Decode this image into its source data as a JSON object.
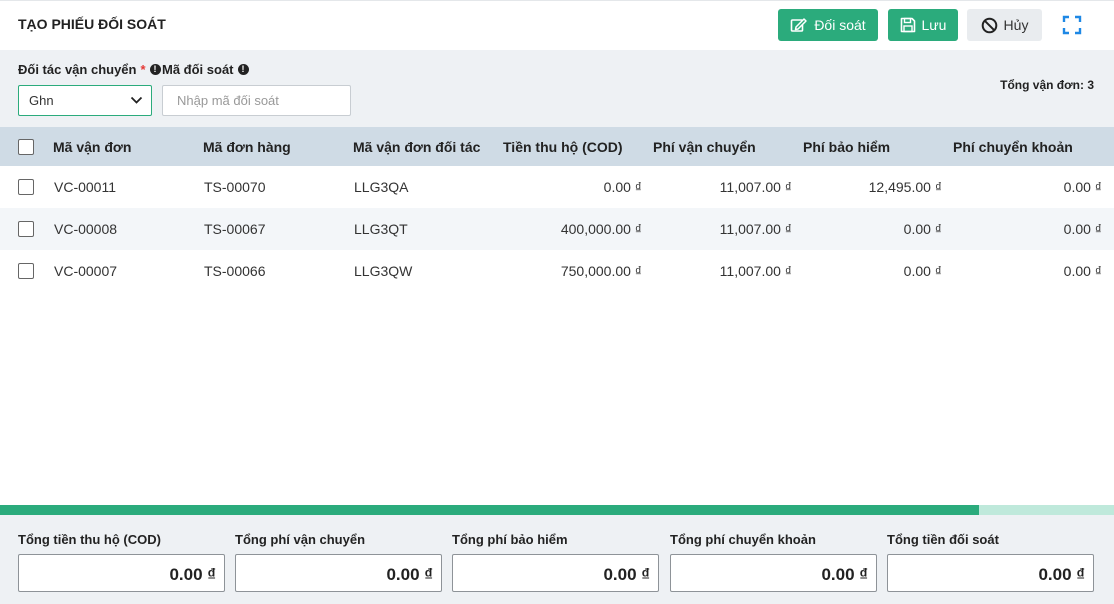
{
  "header": {
    "title": "TẠO PHIẾU ĐỐI SOÁT",
    "reconcile_label": "Đối soát",
    "save_label": "Lưu",
    "cancel_label": "Hủy"
  },
  "filters": {
    "carrier_label": "Đối tác vận chuyển",
    "carrier_required": "*",
    "carrier_value": "Ghn",
    "code_label": "Mã đối soát",
    "code_placeholder": "Nhập mã đối soát",
    "code_value": "",
    "total_orders_text": "Tổng vận đơn: 3"
  },
  "table": {
    "headers": [
      "Mã vận đơn",
      "Mã đơn hàng",
      "Mã vận đơn đối tác",
      "Tiền thu hộ (COD)",
      "Phí vận chuyển",
      "Phí bảo hiểm",
      "Phí chuyển khoản"
    ],
    "rows": [
      [
        "VC-00011",
        "TS-00070",
        "LLG3QA",
        "0.00 ₫",
        "11,007.00 ₫",
        "12,495.00 ₫",
        "0.00 ₫"
      ],
      [
        "VC-00008",
        "TS-00067",
        "LLG3QT",
        "400,000.00 ₫",
        "11,007.00 ₫",
        "0.00 ₫",
        "0.00 ₫"
      ],
      [
        "VC-00007",
        "TS-00066",
        "LLG3QW",
        "750,000.00 ₫",
        "11,007.00 ₫",
        "0.00 ₫",
        "0.00 ₫"
      ]
    ]
  },
  "scroll_progress": 0.879,
  "summary": {
    "items": [
      {
        "label": "Tổng tiền thu hộ (COD)",
        "value": "0.00 ₫"
      },
      {
        "label": "Tổng phí vận chuyển",
        "value": "0.00 ₫"
      },
      {
        "label": "Tổng phí bảo hiểm",
        "value": "0.00 ₫"
      },
      {
        "label": "Tổng phí chuyển khoản",
        "value": "0.00 ₫"
      },
      {
        "label": "Tổng tiền đối soát",
        "value": "0.00 ₫"
      }
    ]
  },
  "colors": {
    "primary": "#2bab7c",
    "header_row": "#cfdbe5",
    "panel": "#eef1f4"
  },
  "icons": [
    "edit-icon",
    "save-icon",
    "ban-icon",
    "expand-icon",
    "chevron-down-icon",
    "info-icon"
  ]
}
